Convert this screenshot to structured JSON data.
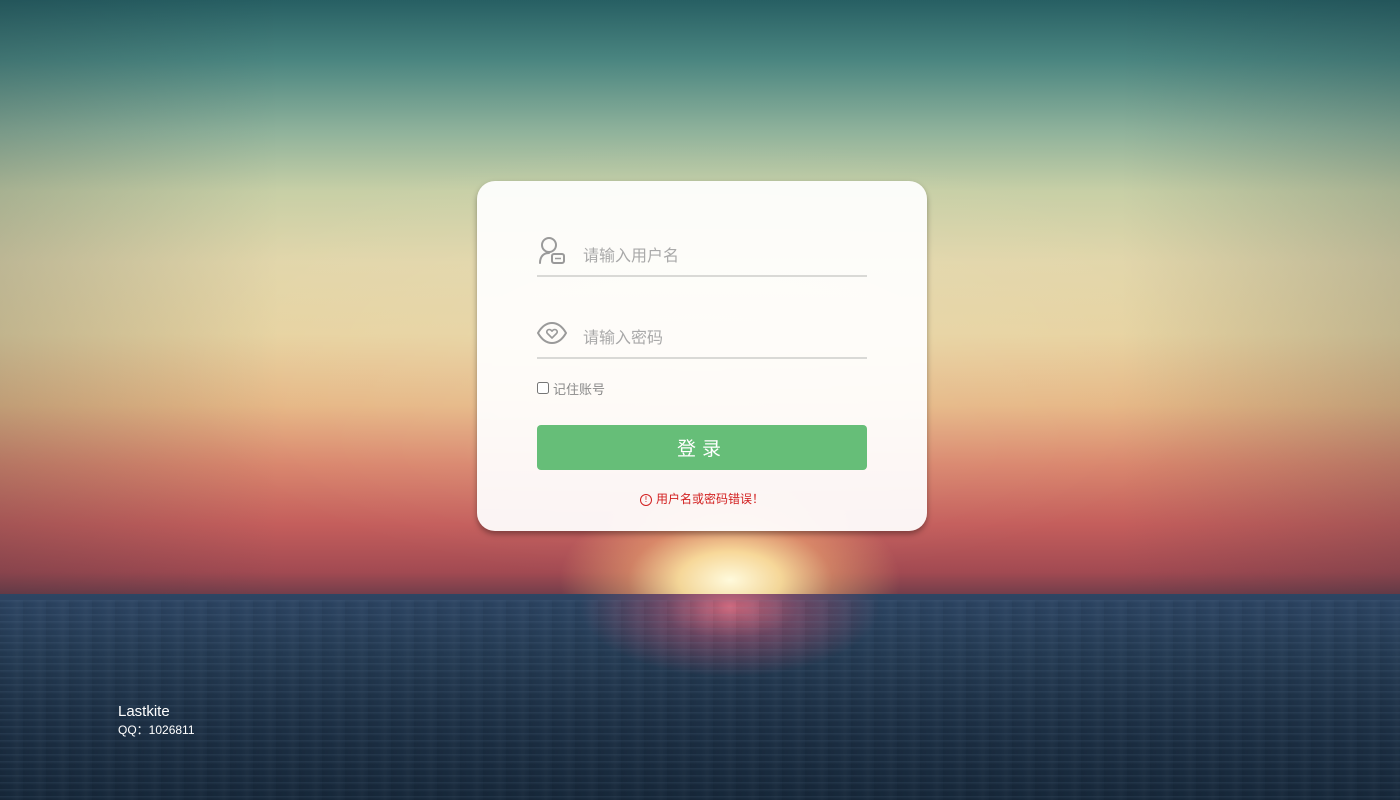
{
  "login_form": {
    "username": {
      "icon": "user-icon",
      "placeholder": "请输入用户名",
      "value": ""
    },
    "password": {
      "icon": "eye-icon",
      "placeholder": "请输入密码",
      "value": ""
    },
    "remember": {
      "label": "记住账号",
      "checked": false
    },
    "submit_label": "登录",
    "error": {
      "icon": "warning-icon",
      "message": "用户名或密码错误！"
    }
  },
  "footer": {
    "name": "Lastkite",
    "contact": "QQ：1026811"
  },
  "colors": {
    "button": "#66be78",
    "error": "#d21f1f",
    "card": "#ffffff"
  }
}
